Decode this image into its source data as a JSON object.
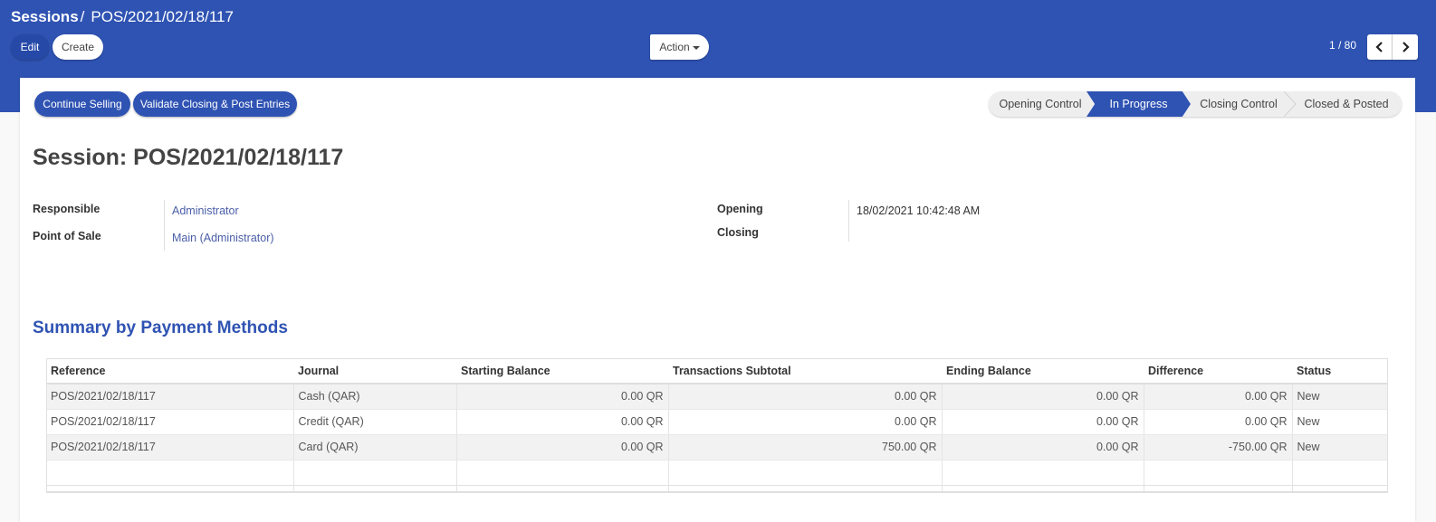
{
  "breadcrumb": {
    "root": "Sessions",
    "separator": "/",
    "current": "POS/2021/02/18/117"
  },
  "controls": {
    "edit": "Edit",
    "create": "Create",
    "action": "Action"
  },
  "pager": {
    "value": "1 / 80"
  },
  "header_buttons": {
    "continue": "Continue Selling",
    "validate": "Validate Closing & Post Entries"
  },
  "statusbar": {
    "stages": [
      "Opening Control",
      "In Progress",
      "Closing Control",
      "Closed & Posted"
    ],
    "active": "In Progress"
  },
  "title": "Session: POS/2021/02/18/117",
  "fields": {
    "responsible_label": "Responsible",
    "responsible_value": "Administrator",
    "pos_label": "Point of Sale",
    "pos_value": "Main (Administrator)",
    "opening_label": "Opening",
    "opening_value": "18/02/2021 10:42:48 AM",
    "closing_label": "Closing",
    "closing_value": ""
  },
  "section_title": "Summary by Payment Methods",
  "table": {
    "headers": [
      "Reference",
      "Journal",
      "Starting Balance",
      "Transactions Subtotal",
      "Ending Balance",
      "Difference",
      "Status"
    ],
    "rows": [
      [
        "POS/2021/02/18/117",
        "Cash (QAR)",
        "0.00 QR",
        "0.00 QR",
        "0.00 QR",
        "0.00 QR",
        "New"
      ],
      [
        "POS/2021/02/18/117",
        "Credit (QAR)",
        "0.00 QR",
        "0.00 QR",
        "0.00 QR",
        "0.00 QR",
        "New"
      ],
      [
        "POS/2021/02/18/117",
        "Card (QAR)",
        "0.00 QR",
        "750.00 QR",
        "0.00 QR",
        "-750.00 QR",
        "New"
      ]
    ]
  },
  "colors": {
    "brand": "#2f53b3",
    "link": "#4a5ea8"
  },
  "icons": {
    "prev": "chevron-left-icon",
    "next": "chevron-right-icon",
    "dropdown": "caret-down-icon"
  }
}
